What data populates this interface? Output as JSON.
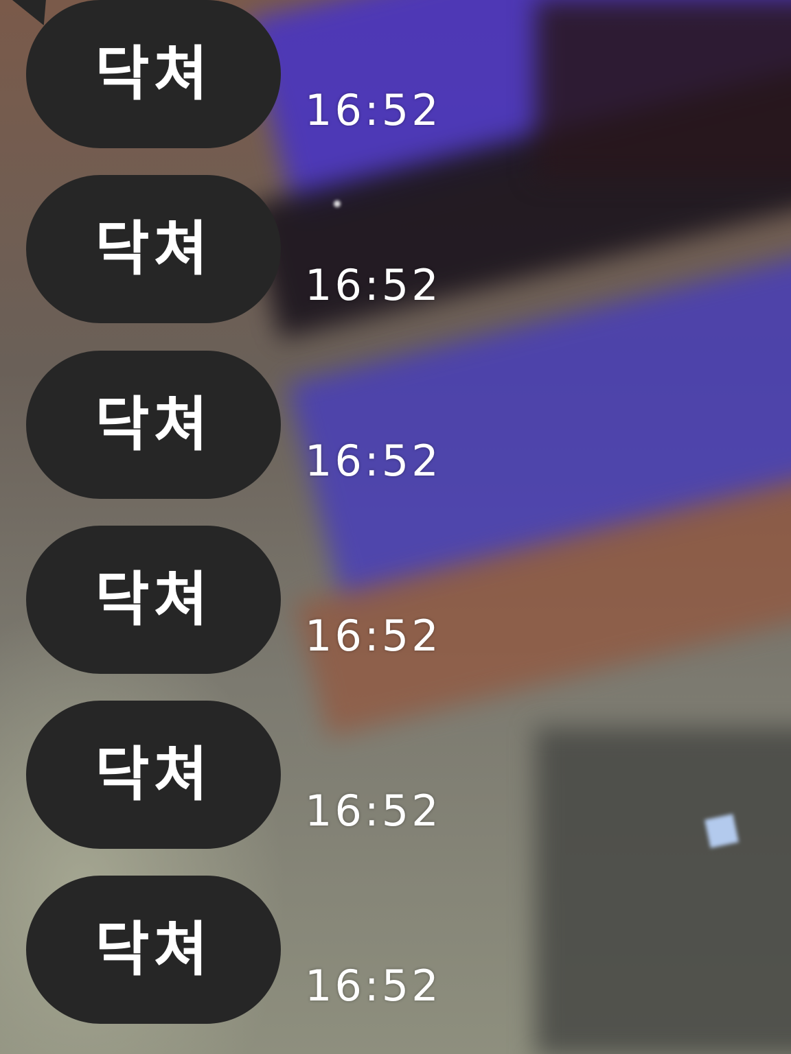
{
  "messages": [
    {
      "text": "닥쳐",
      "time": "16:52"
    },
    {
      "text": "닥쳐",
      "time": "16:52"
    },
    {
      "text": "닥쳐",
      "time": "16:52"
    },
    {
      "text": "닥쳐",
      "time": "16:52"
    },
    {
      "text": "닥쳐",
      "time": "16:52"
    },
    {
      "text": "닥쳐",
      "time": "16:52"
    }
  ],
  "colors": {
    "bubble": "#262626",
    "bubble_text": "#ffffff",
    "time_text": "#ffffff"
  }
}
